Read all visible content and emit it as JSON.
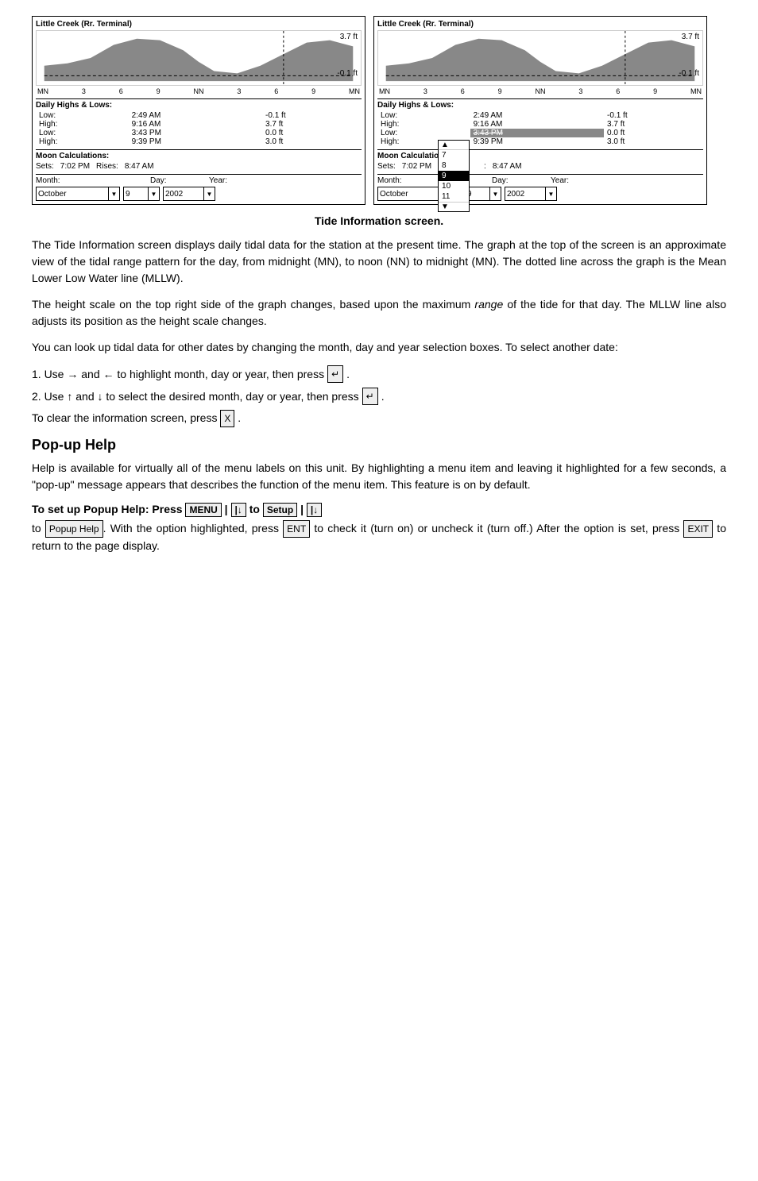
{
  "caption": "Tide Information screen.",
  "screen1": {
    "title": "Little Creek (Rr. Terminal)",
    "high_value": "3.7 ft",
    "low_value": "-0.1 ft",
    "graph_labels": [
      "MN",
      "3",
      "6",
      "9",
      "NN",
      "3",
      "6",
      "9",
      "MN"
    ],
    "daily_section": "Daily Highs & Lows:",
    "rows": [
      {
        "label": "Low:",
        "time": "2:49 AM",
        "value": "-0.1 ft"
      },
      {
        "label": "High:",
        "time": "9:16 AM",
        "value": "3.7 ft"
      },
      {
        "label": "Low:",
        "time": "3:43 PM",
        "value": "0.0 ft"
      },
      {
        "label": "High:",
        "time": "9:39 PM",
        "value": "3.0 ft"
      }
    ],
    "moon_title": "Moon Calculations:",
    "moon_sets": "7:02 PM",
    "moon_rises": "8:47 AM",
    "month_label": "Month:",
    "day_label": "Day:",
    "year_label": "Year:",
    "month_value": "October",
    "day_value": "9",
    "year_value": "2002"
  },
  "screen2": {
    "title": "Little Creek (Rr. Terminal)",
    "high_value": "3.7 ft",
    "low_value": "-0.1 ft",
    "graph_labels": [
      "MN",
      "3",
      "6",
      "9",
      "NN",
      "3",
      "6",
      "9",
      "MN"
    ],
    "daily_section": "Daily Highs & Lows:",
    "rows": [
      {
        "label": "Low:",
        "time": "2:49 AM",
        "value": "-0.1 ft"
      },
      {
        "label": "High:",
        "time": "9:16 AM",
        "value": "3.7 ft"
      },
      {
        "label": "Low:",
        "time": "3:43 PM",
        "value": "0.0 ft"
      },
      {
        "label": "High:",
        "time": "9:39 PM",
        "value": "3.0 ft"
      }
    ],
    "moon_title": "Moon Calculatio",
    "moon_sets": "7:02 PM",
    "moon_rises": "8:47 AM",
    "month_label": "Month:",
    "day_label": "Day:",
    "year_label": "Year:",
    "month_value": "October",
    "day_value": "9",
    "year_value": "2002",
    "dropdown_items": [
      "7",
      "8",
      "9",
      "10",
      "11"
    ],
    "dropdown_selected": "9"
  },
  "body_paragraphs": [
    "The Tide Information screen displays daily tidal data for the station at the present time. The graph at the top of the screen is an approximate view of the tidal range pattern for the day, from midnight (MN), to noon (NN) to midnight (MN). The dotted line across the graph is the Mean Lower Low Water line (MLLW).",
    "The height scale on the top right side of the graph changes, based upon the maximum range of the tide for that day. The MLLW line also adjusts its position as the height scale changes.",
    "You can look up tidal data for other dates by changing the month, day and year selection boxes. To select another date:"
  ],
  "list_items": [
    {
      "num": "1.",
      "text": "Use → and ← to highlight month, day or year, then press"
    },
    {
      "num": "2.",
      "text": "Use ↑ and ↓ to select the desired month, day or year, then press"
    }
  ],
  "clear_text": "To clear the information screen, press",
  "popup_help_heading": "Pop-up Help",
  "popup_help_para": "Help is available for virtually all of the menu labels on this unit. By highlighting a menu item and leaving it highlighted for a few seconds, a \"pop-up\" message appears that describes the function of the menu item. This feature is on by default.",
  "popup_setup_bold": "To set up Popup Help:",
  "popup_setup_press": "Press",
  "popup_setup_pipe1": "|",
  "popup_setup_down1": "|↓ to",
  "popup_setup_pipe2": "|",
  "popup_setup_down2": "|↓",
  "popup_setup_to": "to",
  "popup_setup_with": ". With the option highlighted, press",
  "popup_setup_check": "to check it (turn on) or uncheck it (turn off.) After the option is set, press",
  "popup_setup_return": "to return to the page display."
}
